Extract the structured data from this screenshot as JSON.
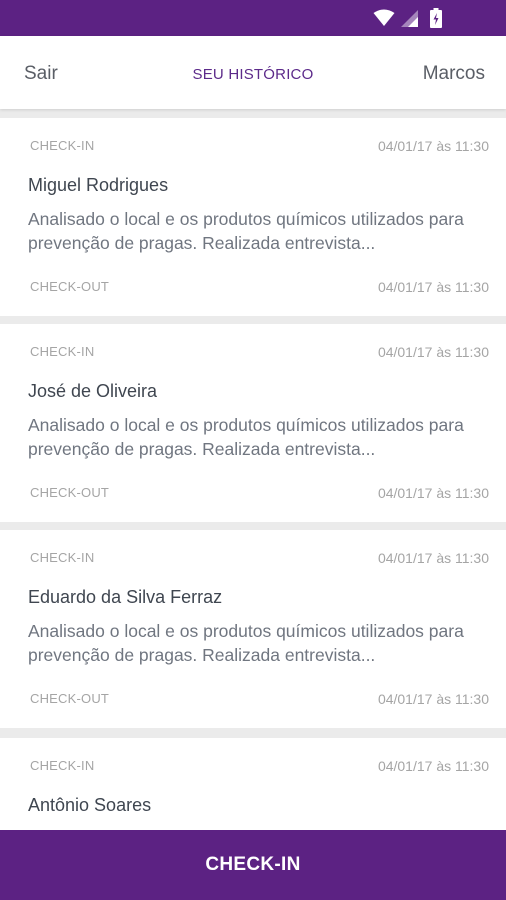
{
  "colors": {
    "brand": "#5c2283",
    "title": "#5c2a8a",
    "muted": "#a5a5a5",
    "name": "#3f4650",
    "body": "#707680"
  },
  "header": {
    "left_action": "Sair",
    "title": "SEU HISTÓRICO",
    "right_action": "Marcos"
  },
  "history": [
    {
      "checkin_label": "CHECK-IN",
      "checkin_time": "04/01/17 às 11:30",
      "name": "Miguel Rodrigues",
      "description": "Analisado o local e os produtos químicos utilizados para prevenção de pragas. Realizada entrevista...",
      "checkout_label": "CHECK-OUT",
      "checkout_time": "04/01/17 às 11:30"
    },
    {
      "checkin_label": "CHECK-IN",
      "checkin_time": "04/01/17 às 11:30",
      "name": "José de Oliveira",
      "description": "Analisado o local e os produtos químicos utilizados para prevenção de pragas. Realizada entrevista...",
      "checkout_label": "CHECK-OUT",
      "checkout_time": "04/01/17 às 11:30"
    },
    {
      "checkin_label": "CHECK-IN",
      "checkin_time": "04/01/17 às 11:30",
      "name": "Eduardo da Silva Ferraz",
      "description": "Analisado o local e os produtos químicos utilizados para prevenção de pragas. Realizada entrevista...",
      "checkout_label": "CHECK-OUT",
      "checkout_time": "04/01/17 às 11:30"
    },
    {
      "checkin_label": "CHECK-IN",
      "checkin_time": "04/01/17 às 11:30",
      "name": "Antônio Soares"
    }
  ],
  "cta": {
    "label": "CHECK-IN"
  }
}
